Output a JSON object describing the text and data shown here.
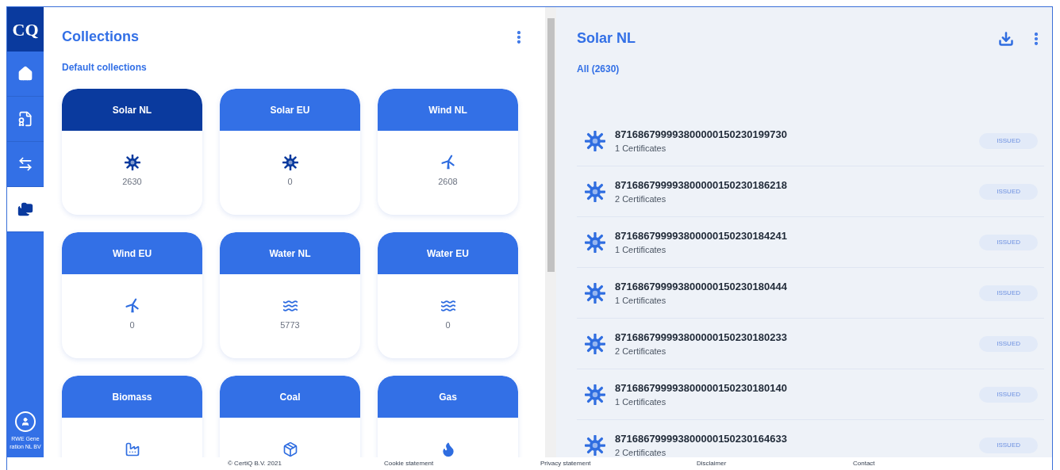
{
  "sidebar": {
    "logo": "CQ",
    "items": [
      {
        "kind": "home",
        "selected": false
      },
      {
        "kind": "certificate",
        "selected": false
      },
      {
        "kind": "transfer",
        "selected": false
      },
      {
        "kind": "folder",
        "selected": true
      }
    ],
    "user": "RWE Gene ration NL BV"
  },
  "collections": {
    "title": "Collections",
    "subtitle": "Default collections",
    "cards": [
      {
        "label": "Solar NL",
        "kind": "solar",
        "count": "2630",
        "selected": true
      },
      {
        "label": "Solar EU",
        "kind": "solar",
        "count": "0",
        "selected": false
      },
      {
        "label": "Wind NL",
        "kind": "wind",
        "count": "2608",
        "selected": false
      },
      {
        "label": "Wind EU",
        "kind": "wind",
        "count": "0",
        "selected": false
      },
      {
        "label": "Water NL",
        "kind": "water",
        "count": "5773",
        "selected": false
      },
      {
        "label": "Water EU",
        "kind": "water",
        "count": "0",
        "selected": false
      },
      {
        "label": "Biomass",
        "kind": "biomass",
        "selected": false
      },
      {
        "label": "Coal",
        "kind": "coal",
        "selected": false
      },
      {
        "label": "Gas",
        "kind": "gas",
        "selected": false
      }
    ]
  },
  "detail": {
    "title": "Solar NL",
    "filter": "All (2630)",
    "items": [
      {
        "id": "871686799993800000150230199730",
        "certificates": "1 Certificates",
        "status": "ISSUED"
      },
      {
        "id": "871686799993800000150230186218",
        "certificates": "2 Certificates",
        "status": "ISSUED"
      },
      {
        "id": "871686799993800000150230184241",
        "certificates": "1 Certificates",
        "status": "ISSUED"
      },
      {
        "id": "871686799993800000150230180444",
        "certificates": "1 Certificates",
        "status": "ISSUED"
      },
      {
        "id": "871686799993800000150230180233",
        "certificates": "2 Certificates",
        "status": "ISSUED"
      },
      {
        "id": "871686799993800000150230180140",
        "certificates": "1 Certificates",
        "status": "ISSUED"
      },
      {
        "id": "871686799993800000150230164633",
        "certificates": "2 Certificates",
        "status": "ISSUED"
      }
    ]
  },
  "footer": [
    "© CertiQ B.V. 2021",
    "Cookie statement",
    "Privacy statement",
    "Disclaimer",
    "Contact"
  ]
}
